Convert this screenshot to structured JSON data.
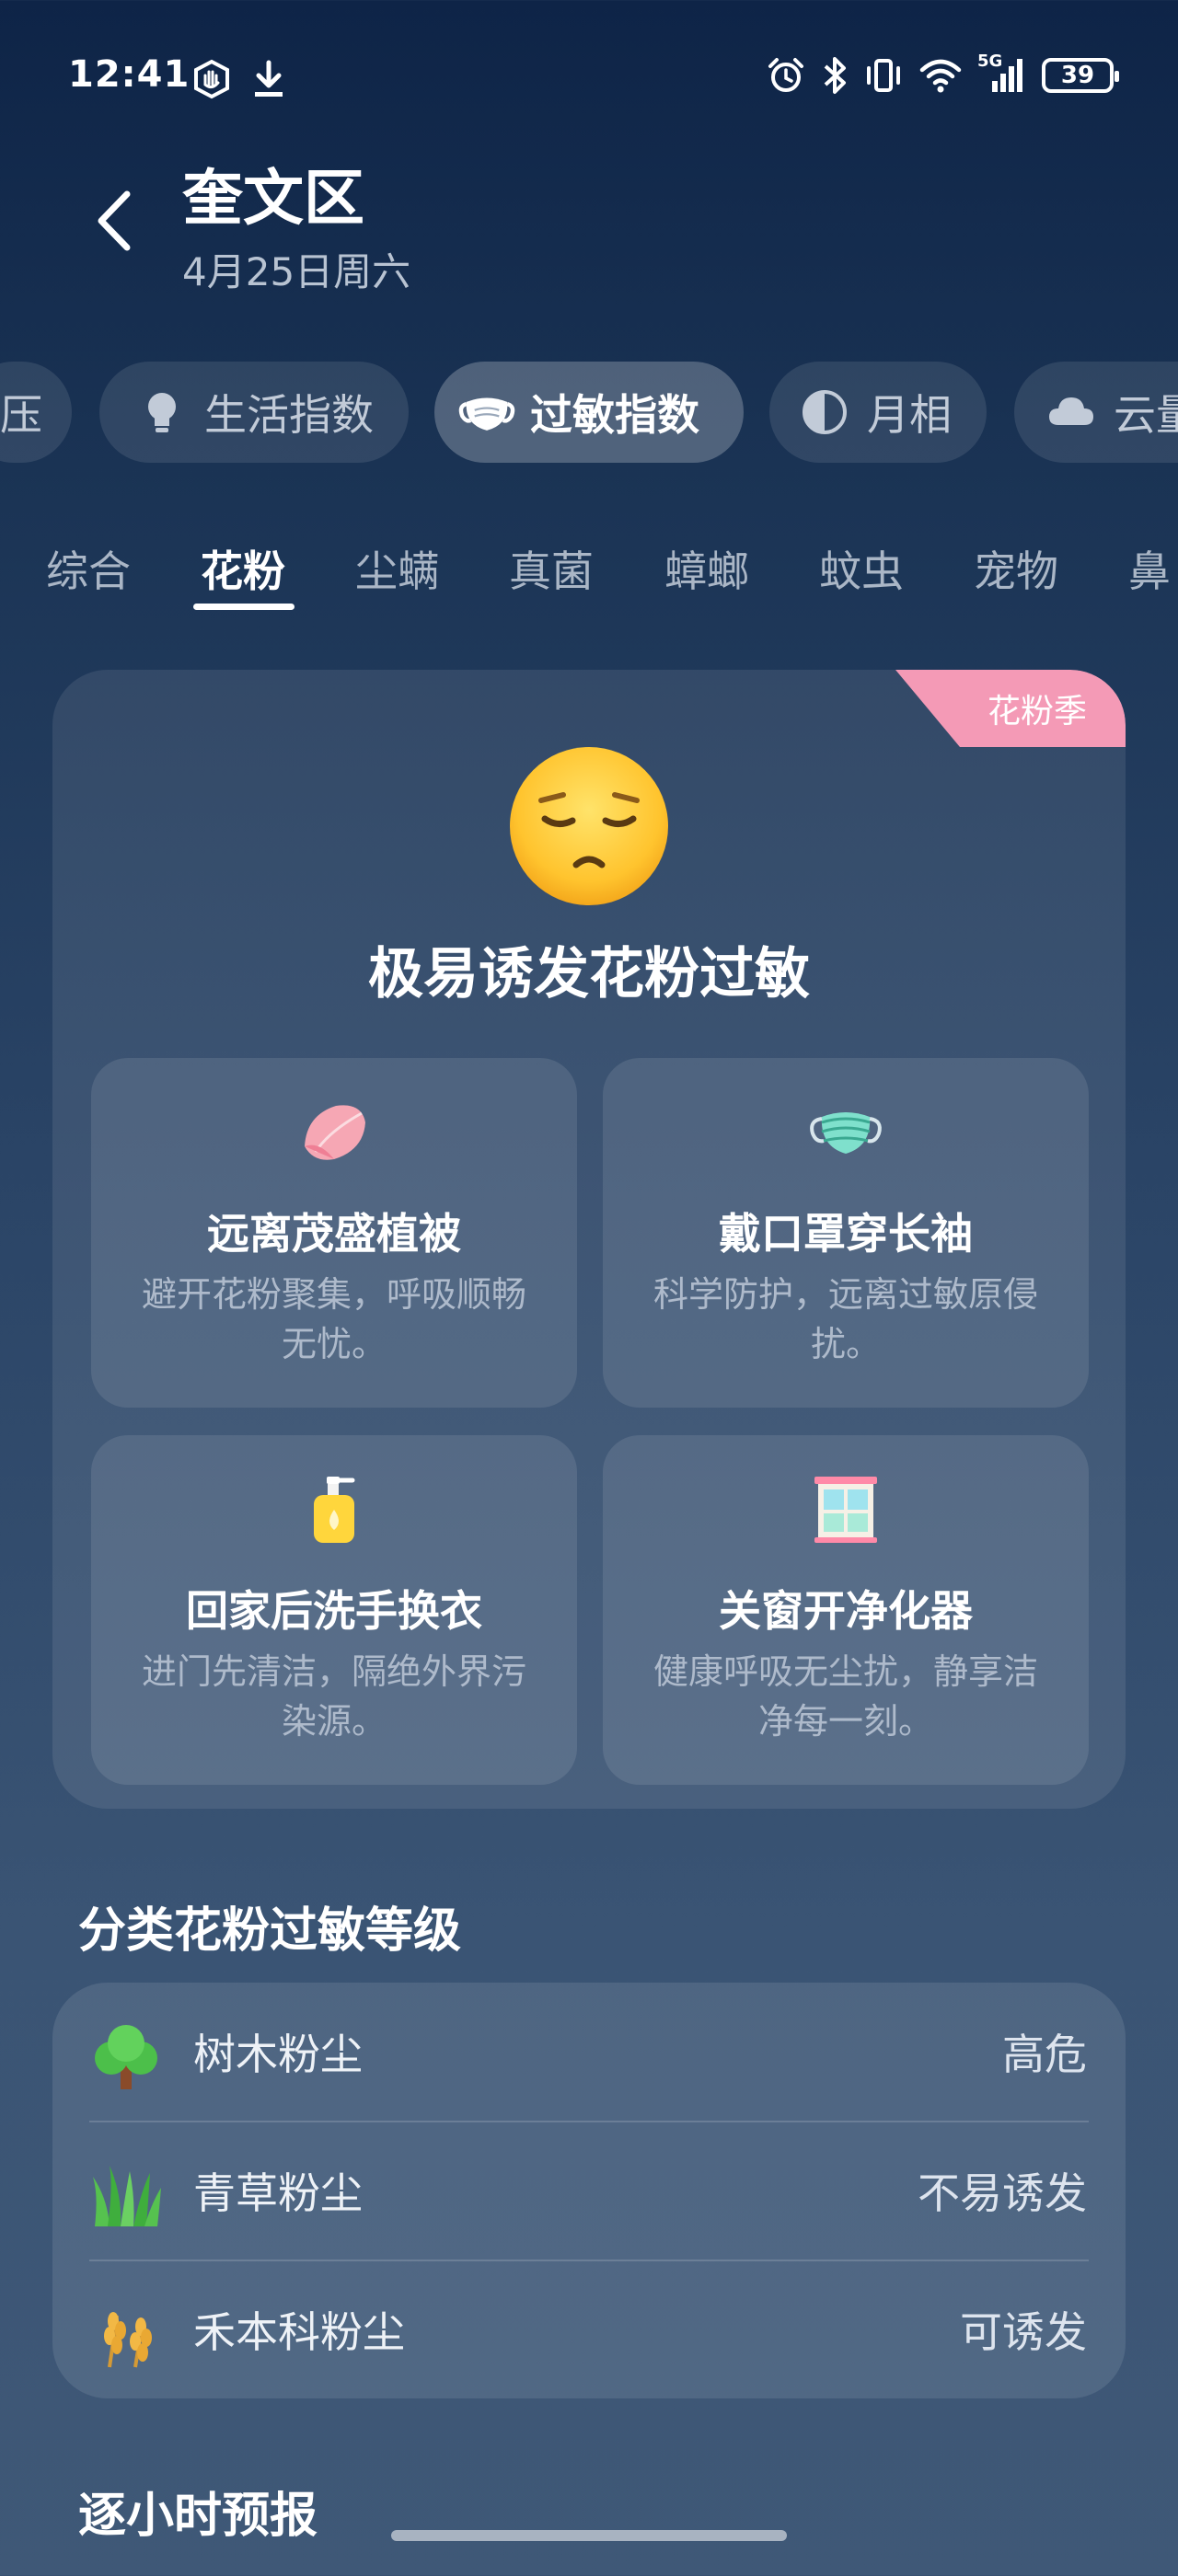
{
  "status_bar": {
    "time": "12:41",
    "network": "5G",
    "battery": "39",
    "icons_left": [
      "hand-stop-icon",
      "download-icon"
    ],
    "icons_right": [
      "alarm-icon",
      "bluetooth-icon",
      "vibrate-icon",
      "wifi-icon",
      "signal-icon",
      "battery-icon"
    ]
  },
  "header": {
    "title": "奎文区",
    "subtitle": "4月25日周六"
  },
  "chips": [
    {
      "label": "压",
      "icon": "pressure-icon",
      "active": false
    },
    {
      "label": "生活指数",
      "icon": "lightbulb-icon",
      "active": false
    },
    {
      "label": "过敏指数",
      "icon": "mask-icon",
      "active": true
    },
    {
      "label": "月相",
      "icon": "moon-phase-icon",
      "active": false
    },
    {
      "label": "云量",
      "icon": "cloud-icon",
      "active": false
    }
  ],
  "subtabs": [
    {
      "label": "综合",
      "active": false
    },
    {
      "label": "花粉",
      "active": true
    },
    {
      "label": "尘螨",
      "active": false
    },
    {
      "label": "真菌",
      "active": false
    },
    {
      "label": "蟑螂",
      "active": false
    },
    {
      "label": "蚊虫",
      "active": false
    },
    {
      "label": "宠物",
      "active": false
    },
    {
      "label": "鼻",
      "active": false
    }
  ],
  "card": {
    "badge": "花粉季",
    "face_icon": "pensive-face-icon",
    "headline": "极易诱发花粉过敏",
    "tips": [
      {
        "icon": "petal-icon",
        "title": "远离茂盛植被",
        "desc": "避开花粉聚集，呼吸顺畅无忧。"
      },
      {
        "icon": "face-mask-icon",
        "title": "戴口罩穿长袖",
        "desc": "科学防护，远离过敏原侵扰。"
      },
      {
        "icon": "soap-bottle-icon",
        "title": "回家后洗手换衣",
        "desc": "进门先清洁，隔绝外界污染源。"
      },
      {
        "icon": "window-icon",
        "title": "关窗开净化器",
        "desc": "健康呼吸无尘扰，静享洁净每一刻。"
      }
    ]
  },
  "pollen_section": {
    "title": "分类花粉过敏等级",
    "rows": [
      {
        "icon": "tree-icon",
        "name": "树木粉尘",
        "level": "高危"
      },
      {
        "icon": "grass-icon",
        "name": "青草粉尘",
        "level": "不易诱发"
      },
      {
        "icon": "wheat-icon",
        "name": "禾本科粉尘",
        "level": "可诱发"
      }
    ]
  },
  "hourly_section": {
    "title": "逐小时预报"
  },
  "colors": {
    "badge_pink": "#f49ab6",
    "bg_top": "#0e2447",
    "bg_bottom": "#3f5877"
  }
}
